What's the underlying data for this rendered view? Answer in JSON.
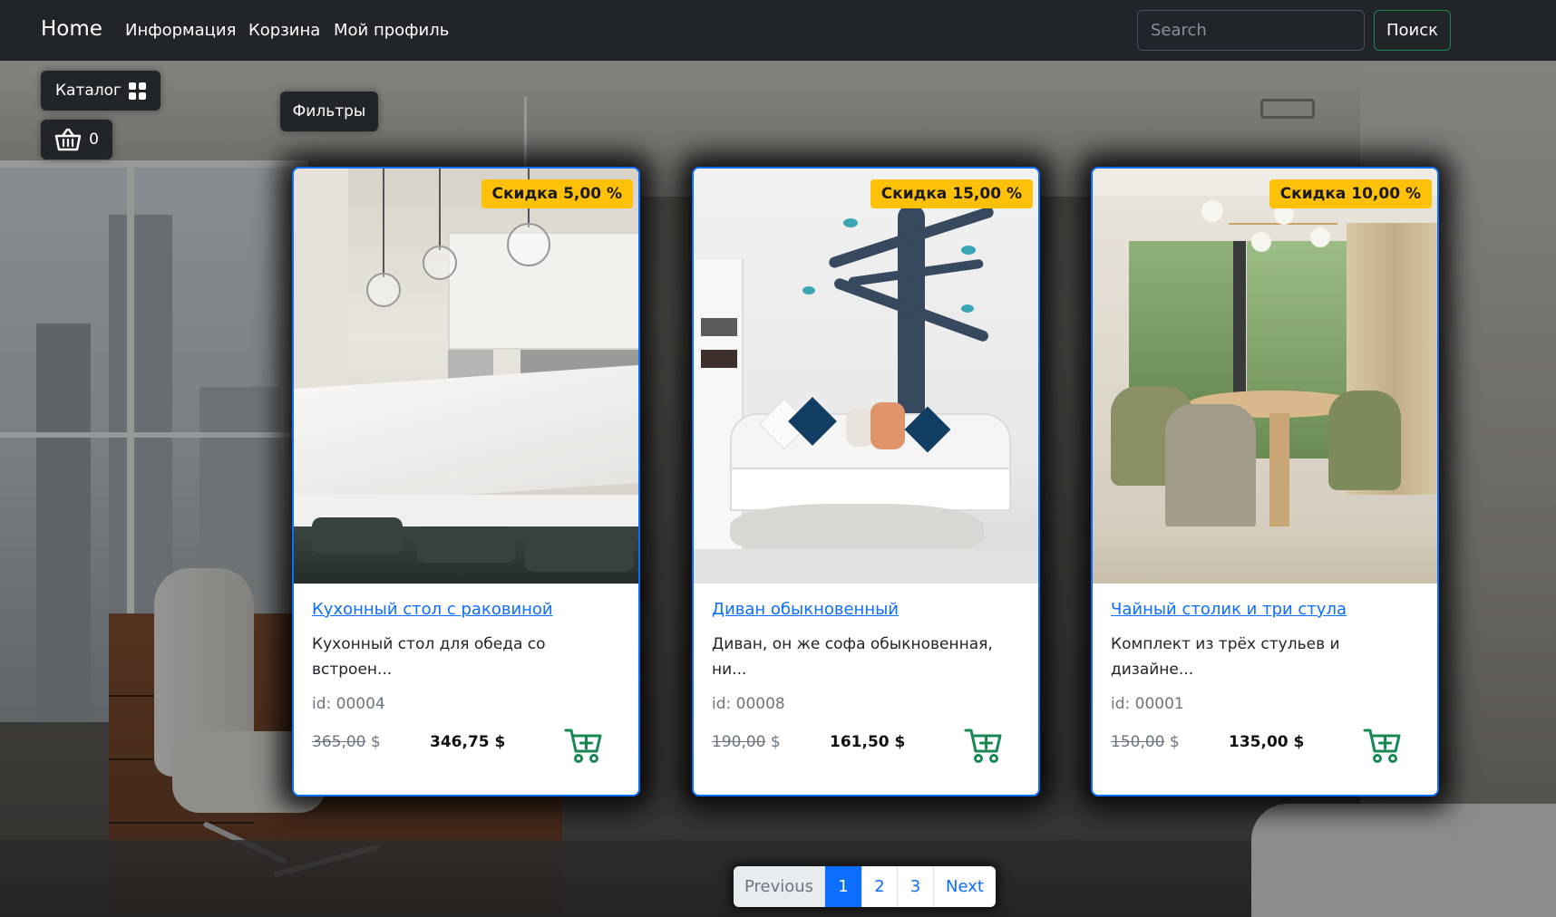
{
  "navbar": {
    "brand": "Home",
    "links": [
      "Информация",
      "Корзина",
      "Мой профиль"
    ],
    "search_placeholder": "Search",
    "search_button": "Поиск"
  },
  "sidebar": {
    "catalog_label": "Каталог",
    "cart_count": "0",
    "filters_label": "Фильтры"
  },
  "products": [
    {
      "badge": "Скидка 5,00 %",
      "title": "Кухонный стол с раковиной",
      "description": "Кухонный стол для обеда со встроен...",
      "id_text": "id: 00004",
      "old_price": "365,00",
      "currency": "$",
      "new_price": "346,75 $",
      "image": "kitchen-island"
    },
    {
      "badge": "Скидка 15,00 %",
      "title": "Диван обыкновенный",
      "description": "Диван, он же софа обыкновенная, ни...",
      "id_text": "id: 00008",
      "old_price": "190,00",
      "currency": "$",
      "new_price": "161,50 $",
      "image": "kids-room-sofa"
    },
    {
      "badge": "Скидка 10,00 %",
      "title": "Чайный столик и три стула",
      "description": "Комплект из трёх стульев и дизайне...",
      "id_text": "id: 00001",
      "old_price": "150,00",
      "currency": "$",
      "new_price": "135,00 $",
      "image": "dining-table-chairs"
    }
  ],
  "pagination": {
    "previous": "Previous",
    "pages": [
      "1",
      "2",
      "3"
    ],
    "active": "1",
    "next": "Next"
  },
  "colors": {
    "navbar": "#212529",
    "link": "#0d6efd",
    "badge": "#ffc107",
    "cart_icon": "#198754",
    "search_border": "#198754"
  },
  "icons": {
    "catalog": "grid-icon",
    "cart": "basket-icon",
    "add_to_cart": "cart-plus-icon"
  }
}
